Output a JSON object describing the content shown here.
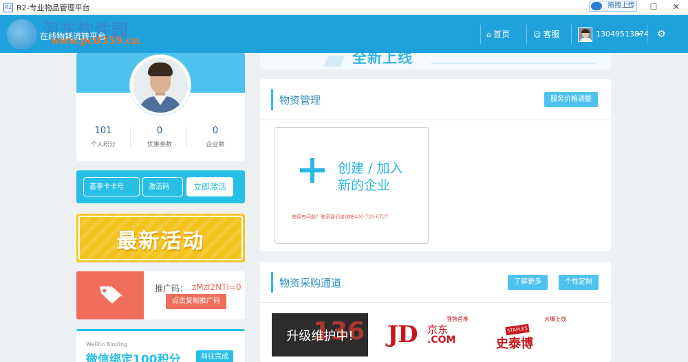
{
  "window": {
    "title": "R2-专业物品管理平台",
    "upload_label": "拖拽上传",
    "app_icon_text": "R2"
  },
  "header": {
    "brand_watermark": "河东软件园",
    "watermark_url": "www.pc0359.cn",
    "slogan": "在线物耗流转平台",
    "nav": {
      "home": "首页",
      "service": "客服",
      "user": "13049513874"
    }
  },
  "profile": {
    "stats": [
      {
        "value": "101",
        "label": "个人积分"
      },
      {
        "value": "0",
        "label": "优惠劵数"
      },
      {
        "value": "0",
        "label": "企业数"
      }
    ]
  },
  "activate": {
    "card_placeholder": "荟享卡卡号",
    "code_placeholder": "激活码",
    "button": "立即激活"
  },
  "events": {
    "label": "最新活动"
  },
  "promo": {
    "label": "推广码：",
    "code": "zMzI2NTI=0",
    "button": "点击复制推广码"
  },
  "wechat": {
    "en_label": "WeiXin Binding",
    "cn_label": "微信绑定100积分",
    "button": "前往完成"
  },
  "banner": {
    "text": "全新上线"
  },
  "material_mgmt": {
    "title": "物资管理",
    "price_button": "服务价格调整",
    "create_line1": "创建 / 加入",
    "create_line2": "新的企业",
    "help_text": "使用有问题？联系我们咨询吧400-728-6727"
  },
  "purchase": {
    "title": "物资采购通道",
    "learn_more": "了解更多",
    "customize": "个性定制",
    "vendors": {
      "maintenance": "升级维护中!",
      "maintenance_bg": "136",
      "jd_logo": "JD",
      "jd_cn": "京东",
      "jd_com": ".COM",
      "jd_tag": "强势首推",
      "staples_badge": "STAPLES",
      "staples_cn": "史泰博",
      "staples_tag": "火爆上线"
    }
  },
  "colors": {
    "header_blue": "#1fa2db",
    "accent_cyan": "#28bfe6",
    "events_yellow": "#f4c21d",
    "promo_red": "#f06d5b",
    "jd_red": "#c8161d"
  }
}
